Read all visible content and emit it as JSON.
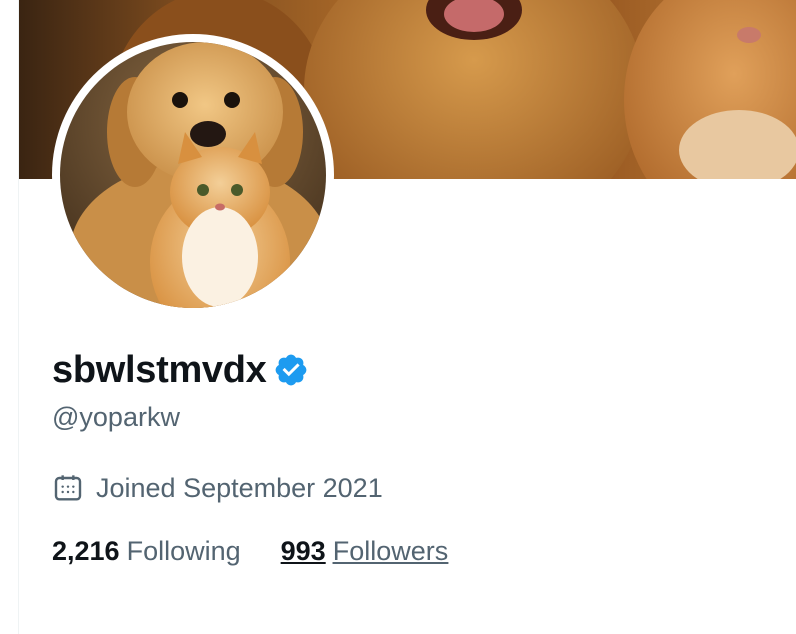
{
  "profile": {
    "display_name": "sbwlstmvdx",
    "handle": "@yoparkw",
    "joined": "Joined September 2021",
    "following_count": "2,216",
    "following_label": "Following",
    "followers_count": "993",
    "followers_label": "Followers"
  },
  "icons": {
    "verified": "verified-badge-icon",
    "calendar": "calendar-icon"
  },
  "colors": {
    "verified_blue": "#1d9bf0",
    "text_primary": "#0f1419",
    "text_secondary": "#536471"
  }
}
